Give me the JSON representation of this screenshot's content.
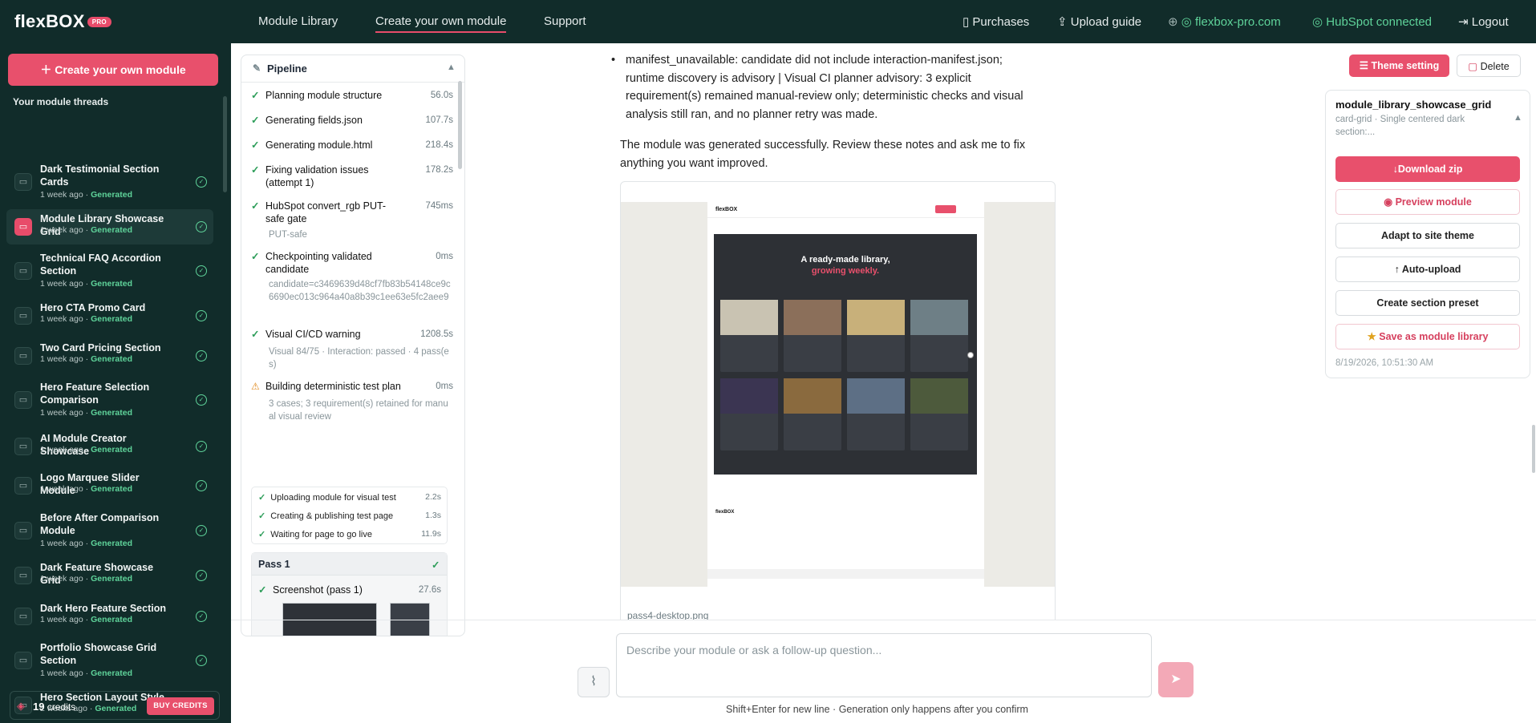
{
  "brand": {
    "name": "flexBOX",
    "badge": "PRO"
  },
  "nav": {
    "module_library": "Module Library",
    "create": "Create your own module",
    "support": "Support",
    "purchases": "Purchases",
    "upload_guide": "Upload guide",
    "site": "flexbox-pro.com",
    "hubspot": "HubSpot connected",
    "logout": "Logout"
  },
  "sidebar": {
    "create_button": "Create your own module",
    "threads_title": "Your module threads",
    "threads": [
      {
        "title": "Dark Testimonial Section Cards",
        "time": "1 week ago",
        "status": "Generated"
      },
      {
        "title": "Module Library Showcase Grid",
        "time": "1 week ago",
        "status": "Generated"
      },
      {
        "title": "Technical FAQ Accordion Section",
        "time": "1 week ago",
        "status": "Generated"
      },
      {
        "title": "Hero CTA Promo Card",
        "time": "1 week ago",
        "status": "Generated"
      },
      {
        "title": "Two Card Pricing Section",
        "time": "1 week ago",
        "status": "Generated"
      },
      {
        "title": "Hero Feature Selection Comparison",
        "time": "1 week ago",
        "status": "Generated"
      },
      {
        "title": "AI Module Creator Showcase",
        "time": "1 week ago",
        "status": "Generated"
      },
      {
        "title": "Logo Marquee Slider Module",
        "time": "1 week ago",
        "status": "Generated"
      },
      {
        "title": "Before After Comparison Module",
        "time": "1 week ago",
        "status": "Generated"
      },
      {
        "title": "Dark Feature Showcase Grid",
        "time": "1 week ago",
        "status": "Generated"
      },
      {
        "title": "Dark Hero Feature Section",
        "time": "1 week ago",
        "status": "Generated"
      },
      {
        "title": "Portfolio Showcase Grid Section",
        "time": "1 week ago",
        "status": "Generated"
      },
      {
        "title": "Hero Section Layout Style",
        "time": "2 weeks ago",
        "status": "Generated"
      }
    ],
    "credits_count": "19",
    "credits_label": "credits",
    "buy_label": "BUY CREDITS"
  },
  "pipeline": {
    "title": "Pipeline",
    "steps": [
      {
        "label": "Planning module structure",
        "time": "56.0s"
      },
      {
        "label": "Generating fields.json",
        "time": "107.7s"
      },
      {
        "label": "Generating module.html",
        "time": "218.4s"
      },
      {
        "label": "Fixing validation issues (attempt 1)",
        "time": "178.2s"
      },
      {
        "label": "HubSpot convert_rgb PUT-safe gate",
        "time": "745ms",
        "sub": "PUT-safe"
      },
      {
        "label": "Checkpointing validated candidate",
        "time": "0ms",
        "sub": "candidate=c3469639d48cf7fb83b54148ce9c6690ec013c964a40a8b39c1ee63e5fc2aee9"
      },
      {
        "label": "Visual CI/CD warning",
        "time": "1208.5s",
        "sub": "Visual 84/75 · Interaction: passed · 4 pass(es)"
      },
      {
        "label": "Building deterministic test plan",
        "time": "0ms",
        "sub": "3 cases; 3 requirement(s) retained for manual visual review"
      }
    ],
    "substeps": [
      {
        "label": "Uploading module for visual test",
        "time": "2.2s"
      },
      {
        "label": "Creating & publishing test page",
        "time": "1.3s"
      },
      {
        "label": "Waiting for page to go live",
        "time": "11.9s"
      }
    ],
    "pass_title": "Pass 1",
    "screenshot_label": "Screenshot (pass 1)",
    "screenshot_time": "27.6s"
  },
  "chat": {
    "bullet": "manifest_unavailable: candidate did not include interaction-manifest.json; runtime discovery is advisory | Visual CI planner advisory: 3 explicit requirement(s) remained manual-review only; deterministic checks and visual analysis still ran, and no planner retry was made.",
    "message": "The module was generated successfully. Review these notes and ask me to fix anything you want improved.",
    "preview_heading": "A ready-made library,",
    "preview_heading2": "growing weekly.",
    "preview_file": "pass4-desktop.png"
  },
  "right": {
    "theme_setting": "Theme setting",
    "delete": "Delete",
    "module_name": "module_library_showcase_grid",
    "module_desc": "card-grid · Single centered dark section:...",
    "download": "Download zip",
    "preview": "Preview module",
    "adapt": "Adapt to site theme",
    "autoupload": "Auto-upload",
    "preset": "Create section preset",
    "save_library": "Save as module library",
    "timestamp": "8/19/2026, 10:51:30 AM"
  },
  "composer": {
    "placeholder": "Describe your module or ask a follow-up question...",
    "hint": "Shift+Enter for new line · Generation only happens after you confirm"
  },
  "colors": {
    "accent": "#e8506c",
    "nav_bg": "#112c2a",
    "success": "#5fd39a"
  }
}
